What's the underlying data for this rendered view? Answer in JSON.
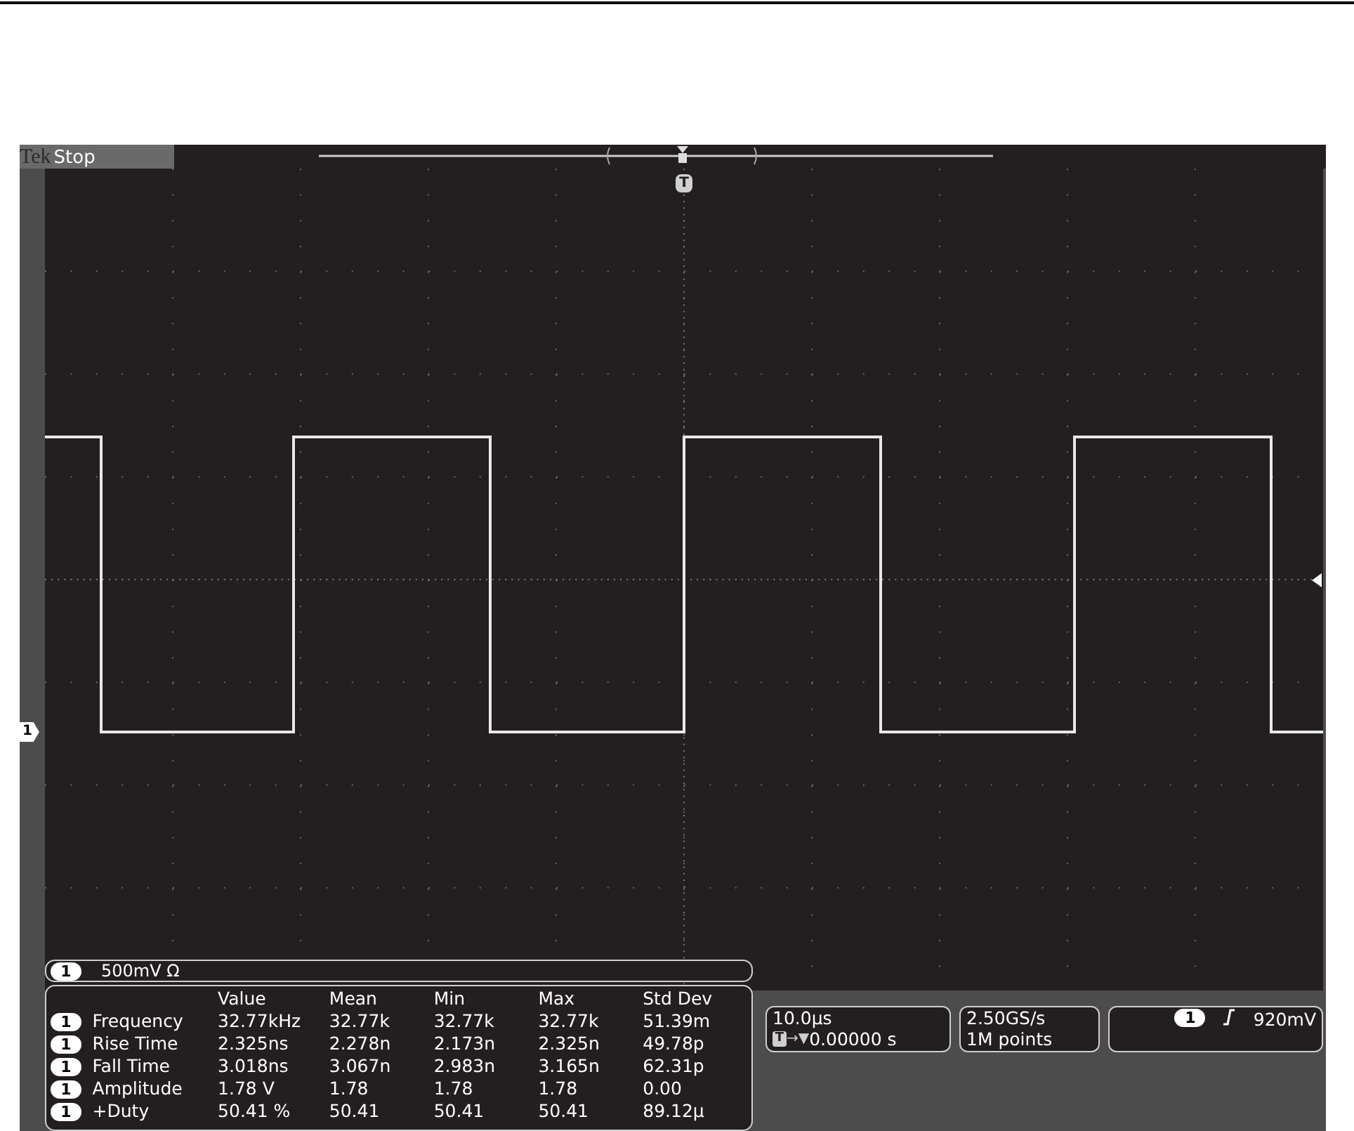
{
  "header": {
    "brand": "Tek",
    "status": "Stop"
  },
  "markers": {
    "trigger_position": "T",
    "channel": "1"
  },
  "channel_readout": {
    "channel": "1",
    "scale": "500mV Ω"
  },
  "measurements": {
    "columns": [
      "Value",
      "Mean",
      "Min",
      "Max",
      "Std Dev"
    ],
    "rows": [
      {
        "channel": "1",
        "name": "Frequency",
        "cells": [
          "32.77kHz",
          "32.77k",
          "32.77k",
          "32.77k",
          "51.39m"
        ]
      },
      {
        "channel": "1",
        "name": "Rise Time",
        "cells": [
          "2.325ns",
          "2.278n",
          "2.173n",
          "2.325n",
          "49.78p"
        ]
      },
      {
        "channel": "1",
        "name": "Fall Time",
        "cells": [
          "3.018ns",
          "3.067n",
          "2.983n",
          "3.165n",
          "62.31p"
        ]
      },
      {
        "channel": "1",
        "name": "Amplitude",
        "cells": [
          "1.78 V",
          "1.78",
          "1.78",
          "1.78",
          "0.00"
        ]
      },
      {
        "channel": "1",
        "name": "+Duty",
        "cells": [
          "50.41 %",
          "50.41",
          "50.41",
          "50.41",
          "89.12µ"
        ]
      }
    ]
  },
  "timebase": {
    "scale": "10.0µs",
    "position_marker": "T",
    "position_arrows": "→▼",
    "position": "0.00000 s"
  },
  "acquisition": {
    "rate": "2.50GS/s",
    "record": "1M points"
  },
  "trigger": {
    "channel": "1",
    "edge": {
      "kind": "rising"
    },
    "level": "920mV"
  }
}
